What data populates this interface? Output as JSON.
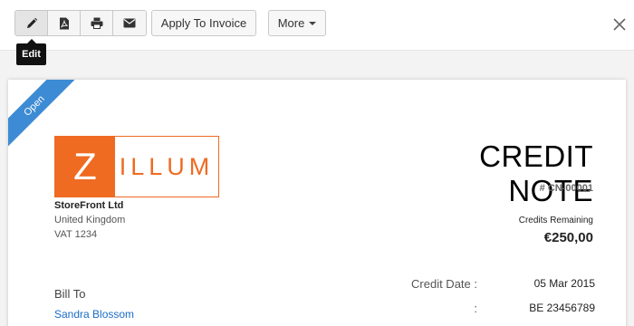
{
  "toolbar": {
    "icons": [
      "pencil-icon",
      "pdf-icon",
      "print-icon",
      "mail-icon"
    ],
    "apply_label": "Apply To Invoice",
    "more_label": "More",
    "tooltip": "Edit"
  },
  "colors": {
    "accent": "#ef6b22",
    "ribbon": "#3d8bd4",
    "link": "#1a6cc8"
  },
  "document": {
    "status": "Open",
    "logo": {
      "initial": "Z",
      "text": "ILLUM"
    },
    "company": {
      "name": "StoreFront Ltd",
      "country": "United Kingdom",
      "vat": "VAT 1234"
    },
    "title": "CREDIT NOTE",
    "number": "# CN-00001",
    "credits_label": "Credits Remaining",
    "credits_value": "€250,00",
    "bill_to_label": "Bill To",
    "client_name": "Sandra Blossom",
    "meta": [
      {
        "label": "Credit Date :",
        "value": "05 Mar 2015"
      },
      {
        "label": ":",
        "value": "BE 23456789"
      }
    ]
  }
}
